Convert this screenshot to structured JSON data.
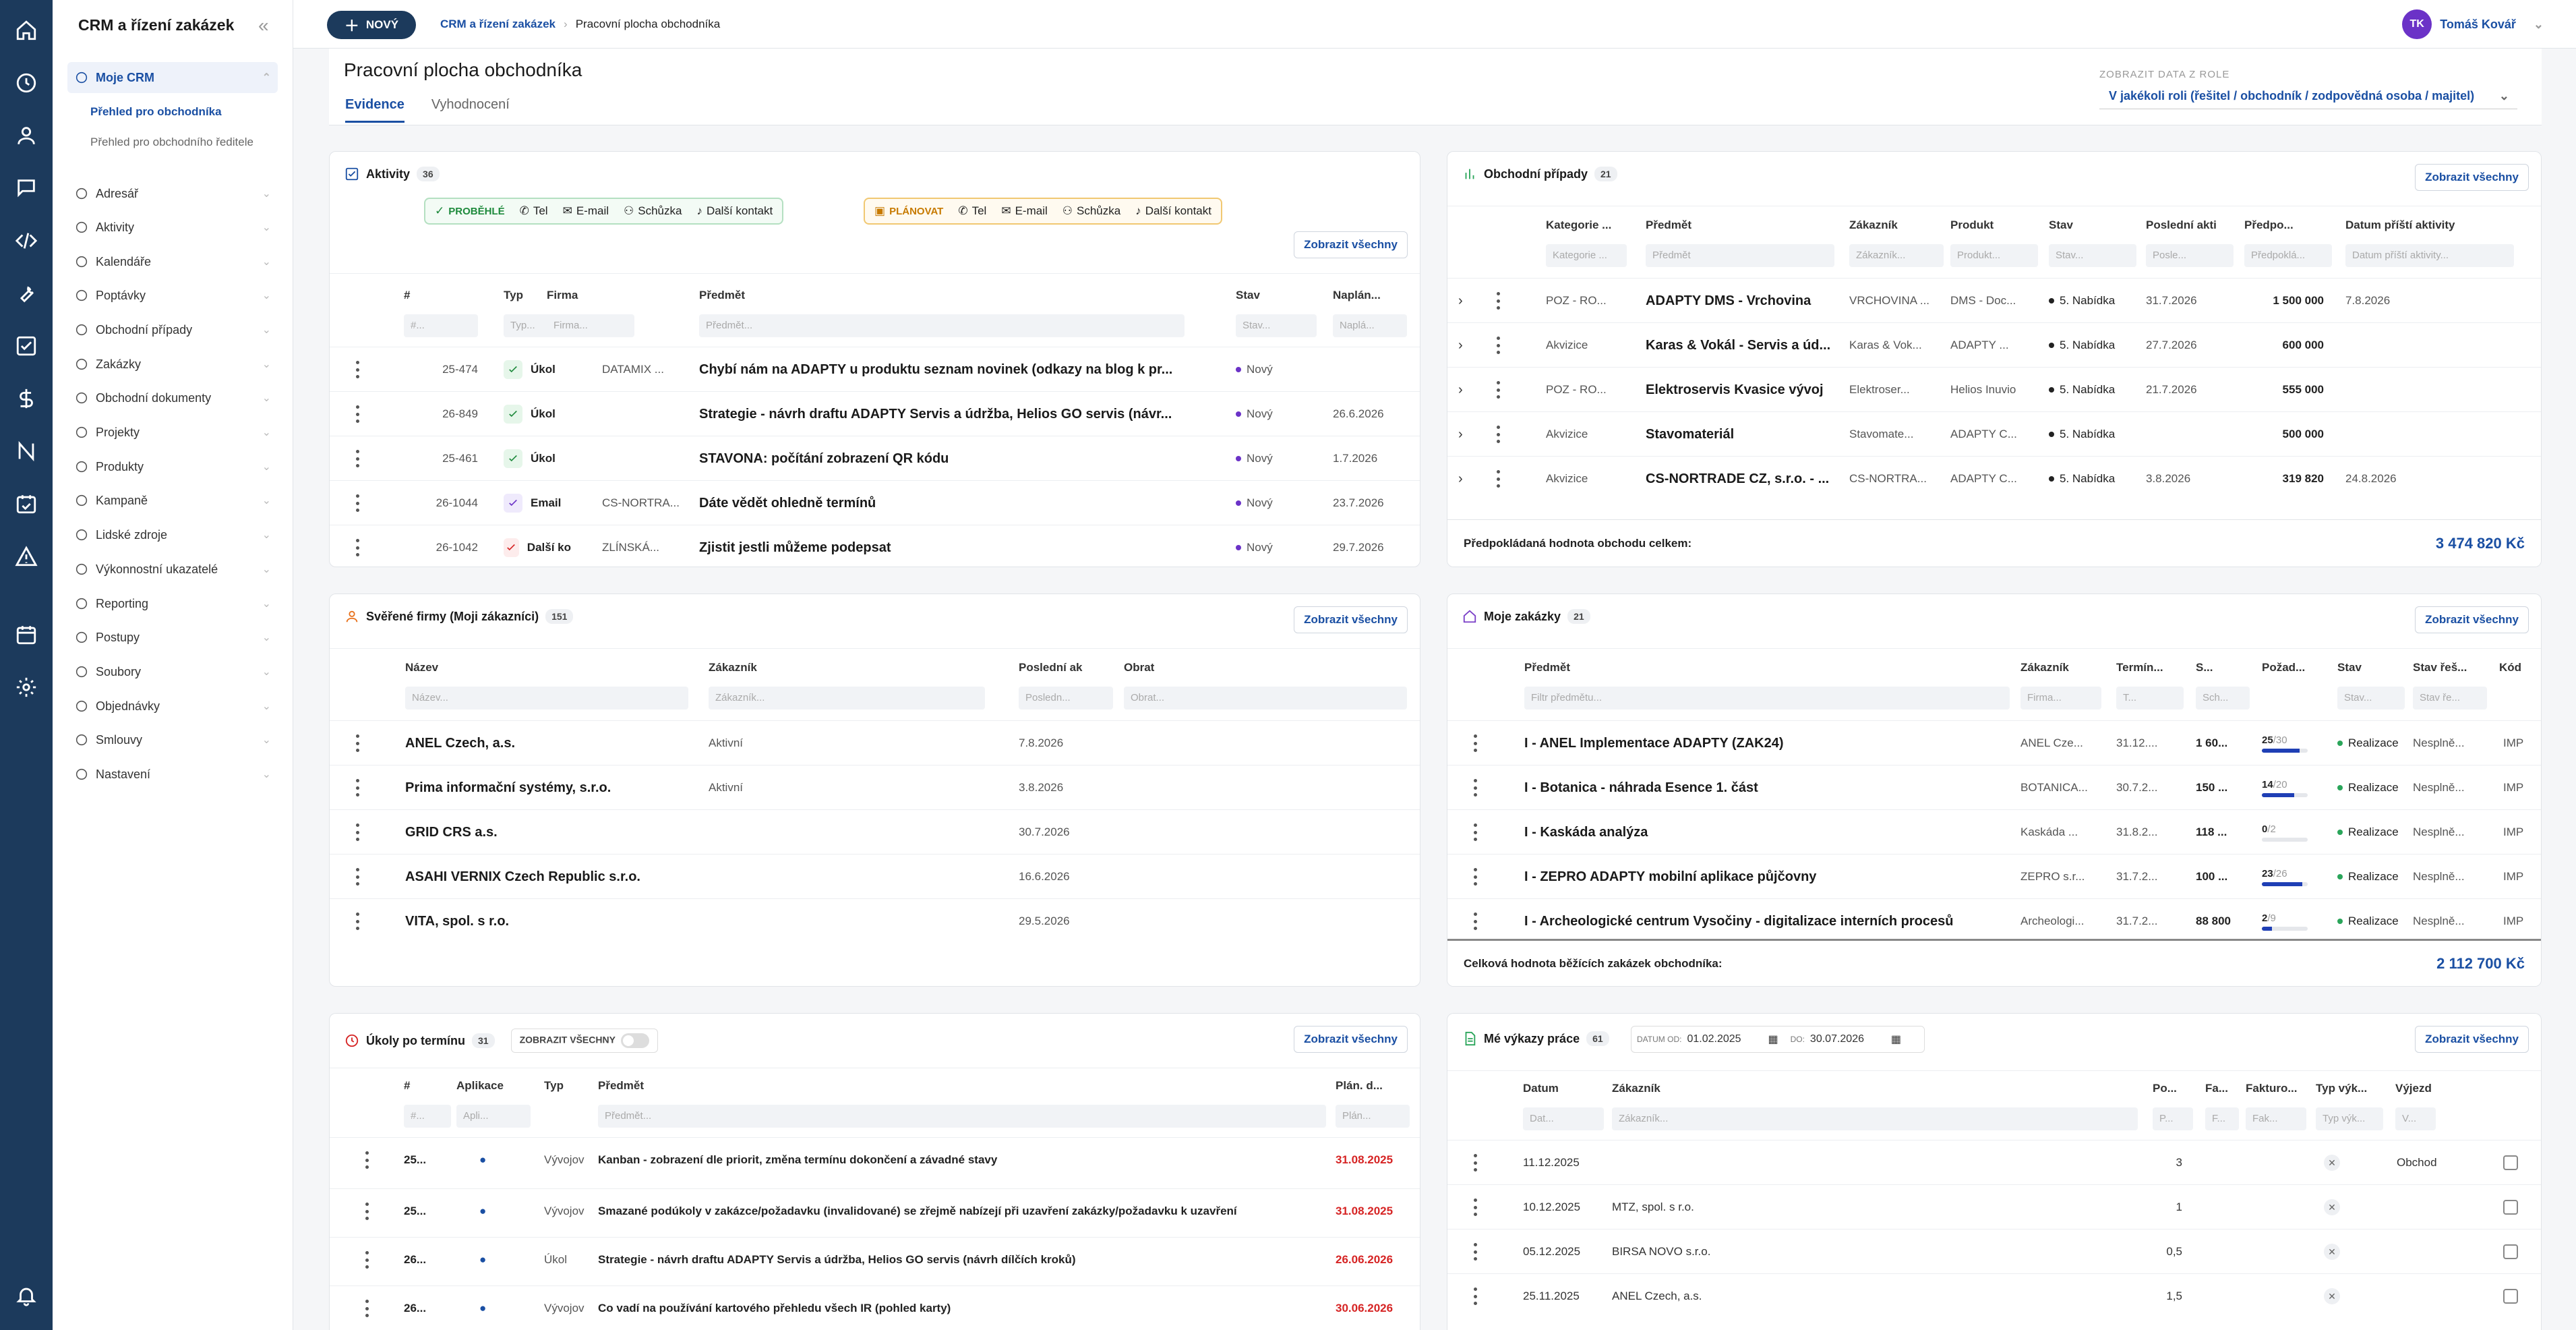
{
  "app": {
    "title": "CRM a řízení zakázek"
  },
  "top": {
    "new_label": "NOVÝ",
    "crumb1": "CRM a řízení zakázek",
    "crumb2": "Pracovní plocha obchodníka",
    "user_name": "Tomáš Kovář",
    "user_initials": "TK"
  },
  "sidebar": {
    "items": [
      {
        "label": "Moje CRM",
        "icon": "help-circle-icon"
      },
      {
        "label": "Adresář",
        "icon": "book-icon"
      },
      {
        "label": "Aktivity",
        "icon": "activity-icon"
      },
      {
        "label": "Kalendáře",
        "icon": "calendar-icon"
      },
      {
        "label": "Poptávky",
        "icon": "question-icon"
      },
      {
        "label": "Obchodní případy",
        "icon": "chat-icon"
      },
      {
        "label": "Zakázky",
        "icon": "dollar-icon"
      },
      {
        "label": "Obchodní dokumenty",
        "icon": "folder-icon"
      },
      {
        "label": "Projekty",
        "icon": "layers-icon"
      },
      {
        "label": "Produkty",
        "icon": "box-icon"
      },
      {
        "label": "Kampaně",
        "icon": "lock-icon"
      },
      {
        "label": "Lidské zdroje",
        "icon": "user-icon"
      },
      {
        "label": "Výkonnostní ukazatelé",
        "icon": "target-icon"
      },
      {
        "label": "Reporting",
        "icon": "bar-chart-icon"
      },
      {
        "label": "Postupy",
        "icon": "check-circle-icon"
      },
      {
        "label": "Soubory",
        "icon": "folder-icon"
      },
      {
        "label": "Objednávky",
        "icon": "cart-icon"
      },
      {
        "label": "Smlouvy",
        "icon": "contract-icon"
      },
      {
        "label": "Nastavení",
        "icon": "gear-icon"
      }
    ],
    "sub": [
      "Přehled pro obchodníka",
      "Přehled pro obchodního ředitele"
    ]
  },
  "page": {
    "title": "Pracovní plocha obchodníka",
    "tab1": "Evidence",
    "tab2": "Vyhodnocení",
    "role_label": "ZOBRAZIT DATA Z ROLE",
    "role_value": "V jakékoli roli (řešitel / obchodník / zodpovědná osoba / majitel)"
  },
  "common": {
    "show_all": "Zobrazit všechny"
  },
  "activities": {
    "title": "Aktivity",
    "count": "36",
    "past": {
      "label": "PROBĚHLÉ",
      "items": [
        "Tel",
        "E-mail",
        "Schůzka",
        "Další kontakt"
      ]
    },
    "plan": {
      "label": "PLÁNOVAT",
      "items": [
        "Tel",
        "E-mail",
        "Schůzka",
        "Další kontakt"
      ]
    },
    "cols": [
      "#",
      "Typ",
      "Firma",
      "Předmět",
      "Stav",
      "Naplán..."
    ],
    "filters": [
      "#...",
      "Typ...",
      "Firma...",
      "Předmět...",
      "Stav...",
      "Naplá..."
    ],
    "rows": [
      {
        "id": "25-474",
        "type": "Úkol",
        "firm": "DATAMIX ...",
        "subject": "Chybí nám na ADAPTY u produktu seznam novinek (odkazy na blog k pr...",
        "state": "Nový",
        "date": ""
      },
      {
        "id": "26-849",
        "type": "Úkol",
        "firm": "",
        "subject": "Strategie - návrh draftu ADAPTY Servis a údržba, Helios GO servis (návr...",
        "state": "Nový",
        "date": "26.6.2026"
      },
      {
        "id": "25-461",
        "type": "Úkol",
        "firm": "",
        "subject": "STAVONA:  počítání zobrazení QR kódu",
        "state": "Nový",
        "date": "1.7.2026"
      },
      {
        "id": "26-1044",
        "type": "Email",
        "firm": "CS-NORTRA...",
        "subject": "Dáte vědět ohledně termínů",
        "state": "Nový",
        "date": "23.7.2026"
      },
      {
        "id": "26-1042",
        "type": "Další ko",
        "firm": "ZLÍNSKÁ...",
        "subject": "Zjistit jestli můžeme podepsat",
        "state": "Nový",
        "date": "29.7.2026"
      }
    ]
  },
  "deals": {
    "title": "Obchodní případy",
    "count": "21",
    "cols": [
      "Kategorie ...",
      "Předmět",
      "Zákazník",
      "Produkt",
      "Stav",
      "Poslední akti",
      "Předpo...",
      "Datum příští aktivity"
    ],
    "filters": [
      "Kategorie ...",
      "Předmět",
      "Zákazník...",
      "Produkt...",
      "Stav...",
      "Posle...",
      "Předpoklá...",
      "Datum příští aktivity..."
    ],
    "rows": [
      {
        "cat": "POZ - RO...",
        "subject": "ADAPTY DMS - Vrchovina",
        "cust": "VRCHOVINA ...",
        "prod": "DMS - Doc...",
        "state": "5. Nabídka",
        "last": "31.7.2026",
        "value": "1 500 000",
        "next": "7.8.2026"
      },
      {
        "cat": "Akvizice",
        "subject": "Karas & Vokál - Servis a úd...",
        "cust": "Karas & Vok...",
        "prod": "ADAPTY ...",
        "state": "5. Nabídka",
        "last": "27.7.2026",
        "value": "600 000",
        "next": ""
      },
      {
        "cat": "POZ - RO...",
        "subject": "Elektroservis Kvasice vývoj",
        "cust": "Elektroser...",
        "prod": "Helios Inuvio",
        "state": "5. Nabídka",
        "last": "21.7.2026",
        "value": "555 000",
        "next": ""
      },
      {
        "cat": "Akvizice",
        "subject": "Stavomateriál",
        "cust": "Stavomate...",
        "prod": "ADAPTY C...",
        "state": "5. Nabídka",
        "last": "",
        "value": "500 000",
        "next": ""
      },
      {
        "cat": "Akvizice",
        "subject": "CS-NORTRADE CZ, s.r.o. - ...",
        "cust": "CS-NORTRA...",
        "prod": "ADAPTY C...",
        "state": "5. Nabídka",
        "last": "3.8.2026",
        "value": "319 820",
        "next": "24.8.2026"
      }
    ],
    "footer_label": "Předpokládaná hodnota obchodu celkem:",
    "footer_value": "3 474 820 Kč"
  },
  "firms": {
    "title": "Svěřené firmy (Moji zákazníci)",
    "count": "151",
    "cols": [
      "Název",
      "Zákazník",
      "Poslední ak",
      "Obrat"
    ],
    "filters": [
      "Název...",
      "Zákazník...",
      "Posledn...",
      "Obrat..."
    ],
    "rows": [
      {
        "name": "ANEL Czech, a.s.",
        "cust": "Aktivní",
        "last": "7.8.2026"
      },
      {
        "name": "Prima informační systémy, s.r.o.",
        "cust": "Aktivní",
        "last": "3.8.2026"
      },
      {
        "name": "GRID CRS a.s.",
        "cust": "",
        "last": "30.7.2026"
      },
      {
        "name": "ASAHI VERNIX Czech Republic s.r.o.",
        "cust": "",
        "last": "16.6.2026"
      },
      {
        "name": "VITA, spol. s r.o.",
        "cust": "",
        "last": "29.5.2026"
      }
    ]
  },
  "orders": {
    "title": "Moje zakázky",
    "count": "21",
    "cols": [
      "Předmět",
      "Zákazník",
      "Termín...",
      "S...",
      "Požad...",
      "Stav",
      "Stav řeš...",
      "Kód"
    ],
    "filters": [
      "Filtr předmětu...",
      "Firma...",
      "T...",
      "Sch...",
      "",
      "Stav...",
      "Stav ře...",
      ""
    ],
    "rows": [
      {
        "subject": "I - ANEL Implementace ADAPTY (ZAK24)",
        "cust": "ANEL Cze...",
        "term": "31.12....",
        "sum": "1 60...",
        "done": 25,
        "total": 30,
        "state": "Realizace",
        "solve": "Nesplně...",
        "code": "IMP"
      },
      {
        "subject": "I - Botanica - náhrada Esence 1. část",
        "cust": "BOTANICA...",
        "term": "30.7.2...",
        "sum": "150 ...",
        "done": 14,
        "total": 20,
        "state": "Realizace",
        "solve": "Nesplně...",
        "code": "IMP"
      },
      {
        "subject": "I - Kaskáda analýza",
        "cust": "Kaskáda ...",
        "term": "31.8.2...",
        "sum": "118 ...",
        "done": 0,
        "total": 2,
        "state": "Realizace",
        "solve": "Nesplně...",
        "code": "IMP"
      },
      {
        "subject": "I - ZEPRO ADAPTY mobilní aplikace půjčovny",
        "cust": "ZEPRO s.r...",
        "term": "31.7.2...",
        "sum": "100 ...",
        "done": 23,
        "total": 26,
        "state": "Realizace",
        "solve": "Nesplně...",
        "code": "IMP"
      },
      {
        "subject": "I - Archeologické centrum Vysočiny - digitalizace interních procesů",
        "cust": "Archeologi...",
        "term": "31.7.2...",
        "sum": "88 800",
        "done": 2,
        "total": 9,
        "state": "Realizace",
        "solve": "Nesplně...",
        "code": "IMP"
      }
    ],
    "footer_label": "Celková hodnota běžících zakázek obchodníka:",
    "footer_value": "2 112 700 Kč"
  },
  "tasks": {
    "title": "Úkoly po termínu",
    "count": "31",
    "toggle_label": "ZOBRAZIT VŠECHNY",
    "cols": [
      "#",
      "Aplikace",
      "Typ",
      "Předmět",
      "Plán. d..."
    ],
    "filters": [
      "#...",
      "Apli...",
      "",
      "Předmět...",
      "Plán..."
    ],
    "rows": [
      {
        "id": "25...",
        "type": "Vývojov",
        "subject": "Kanban - zobrazení dle priorit, změna termínu dokončení a závadné stavy",
        "date": "31.08.2025"
      },
      {
        "id": "25...",
        "type": "Vývojov",
        "subject": "Smazané podúkoly v zakázce/požadavku (invalidované) se zřejmě nabízejí při uzavření zakázky/požadavku k uzavření",
        "date": "31.08.2025"
      },
      {
        "id": "26...",
        "type": "Úkol",
        "subject": "Strategie - návrh draftu ADAPTY Servis a údržba, Helios GO servis (návrh dílčích kroků)",
        "date": "26.06.2026"
      },
      {
        "id": "26...",
        "type": "Vývojov",
        "subject": "Co vadí na používání kartového přehledu všech IR (pohled karty)",
        "date": "30.06.2026"
      }
    ]
  },
  "timesheet": {
    "title": "Mé výkazy práce",
    "count": "61",
    "from_label": "DATUM OD:",
    "from": "01.02.2025",
    "to_label": "DO:",
    "to": "30.07.2026",
    "cols": [
      "Datum",
      "Zákazník",
      "Po...",
      "Fa...",
      "Fakturo...",
      "Typ výk...",
      "Výjezd"
    ],
    "filters": [
      "Dat...",
      "Zákazník...",
      "P...",
      "F...",
      "Fak...",
      "Typ výk...",
      "V..."
    ],
    "rows": [
      {
        "date": "11.12.2025",
        "cust": "",
        "hours": "3",
        "type": "Obchod"
      },
      {
        "date": "10.12.2025",
        "cust": "MTZ, spol. s r.o.",
        "hours": "1",
        "type": ""
      },
      {
        "date": "05.12.2025",
        "cust": "BIRSA NOVO s.r.o.",
        "hours": "0,5",
        "type": ""
      },
      {
        "date": "25.11.2025",
        "cust": "ANEL Czech, a.s.",
        "hours": "1,5",
        "type": ""
      }
    ]
  }
}
